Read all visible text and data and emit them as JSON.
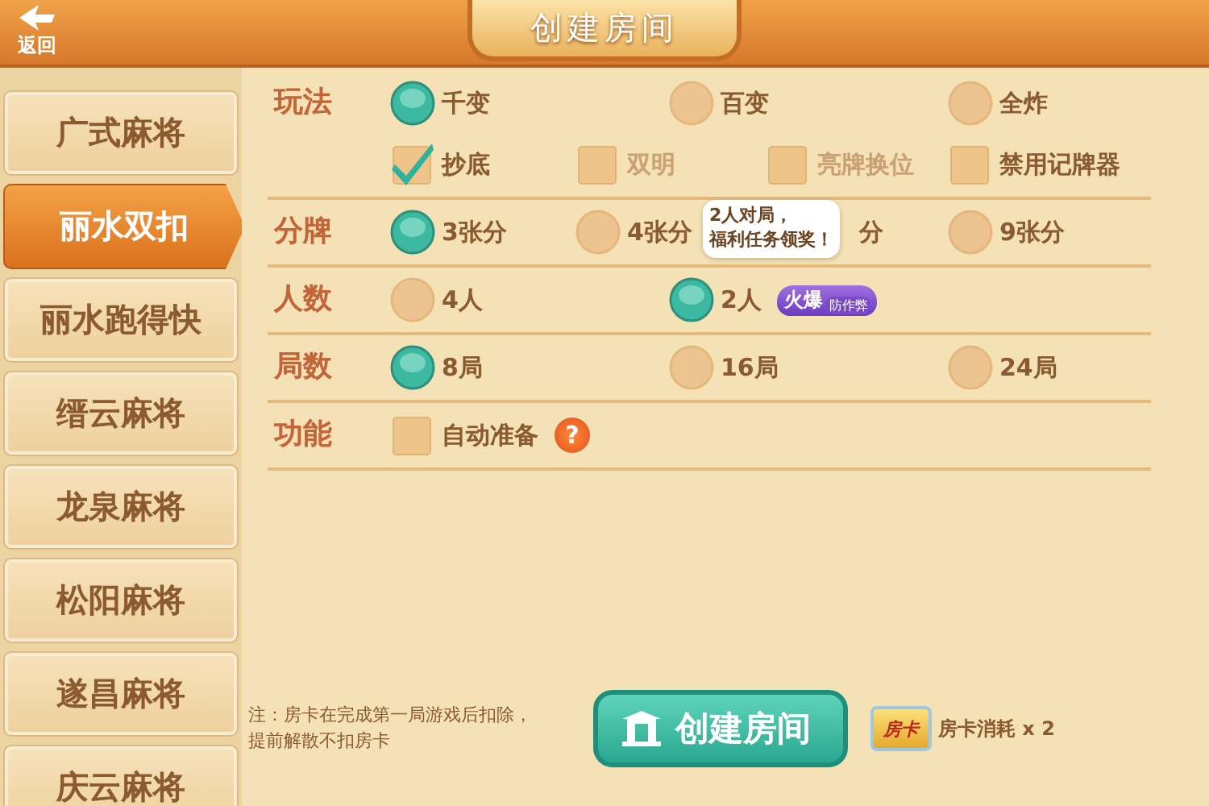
{
  "header": {
    "back_label": "返回",
    "title": "创建房间"
  },
  "sidebar": {
    "items": [
      {
        "label": "广式麻将",
        "selected": false
      },
      {
        "label": "丽水双扣",
        "selected": true
      },
      {
        "label": "丽水跑得快",
        "selected": false
      },
      {
        "label": "缙云麻将",
        "selected": false
      },
      {
        "label": "龙泉麻将",
        "selected": false
      },
      {
        "label": "松阳麻将",
        "selected": false
      },
      {
        "label": "遂昌麻将",
        "selected": false
      },
      {
        "label": "庆云麻将",
        "selected": false
      }
    ]
  },
  "rows": [
    {
      "label": "玩法",
      "lines": [
        [
          {
            "kind": "radio",
            "label": "千变",
            "selected": true
          },
          {
            "kind": "radio",
            "label": "百变",
            "selected": false
          },
          {
            "kind": "radio",
            "label": "全炸",
            "selected": false
          }
        ],
        [
          {
            "kind": "checkbox",
            "label": "抄底",
            "checked": true,
            "disabled": false
          },
          {
            "kind": "checkbox",
            "label": "双明",
            "checked": false,
            "disabled": true
          },
          {
            "kind": "checkbox",
            "label": "亮牌换位",
            "checked": false,
            "disabled": true
          },
          {
            "kind": "checkbox",
            "label": "禁用记牌器",
            "checked": false,
            "disabled": false
          }
        ]
      ]
    },
    {
      "label": "分牌",
      "lines": [
        [
          {
            "kind": "radio",
            "label": "3张分",
            "selected": true
          },
          {
            "kind": "radio",
            "label": "4张分",
            "selected": false
          },
          {
            "kind": "covered",
            "label": "分"
          },
          {
            "kind": "radio",
            "label": "9张分",
            "selected": false
          }
        ]
      ]
    },
    {
      "label": "人数",
      "lines": [
        [
          {
            "kind": "radio",
            "label": "4人",
            "selected": false
          },
          {
            "kind": "radio",
            "label": "2人",
            "selected": true,
            "badge": {
              "main": "火爆",
              "sub": "防作弊"
            },
            "tooltip": [
              "2人对局，",
              "福利任务领奖！"
            ]
          }
        ]
      ]
    },
    {
      "label": "局数",
      "lines": [
        [
          {
            "kind": "radio",
            "label": "8局",
            "selected": true
          },
          {
            "kind": "radio",
            "label": "16局",
            "selected": false
          },
          {
            "kind": "radio",
            "label": "24局",
            "selected": false
          }
        ]
      ]
    },
    {
      "label": "功能",
      "lines": [
        [
          {
            "kind": "checkbox",
            "label": "自动准备",
            "checked": false,
            "disabled": false,
            "help": "?"
          }
        ]
      ]
    }
  ],
  "footer": {
    "note": [
      "注：房卡在完成第一局游戏后扣除，",
      "提前解散不扣房卡"
    ],
    "create_button": "创建房间",
    "card_icon_text": "房卡",
    "cost": "房卡消耗 x 2"
  }
}
